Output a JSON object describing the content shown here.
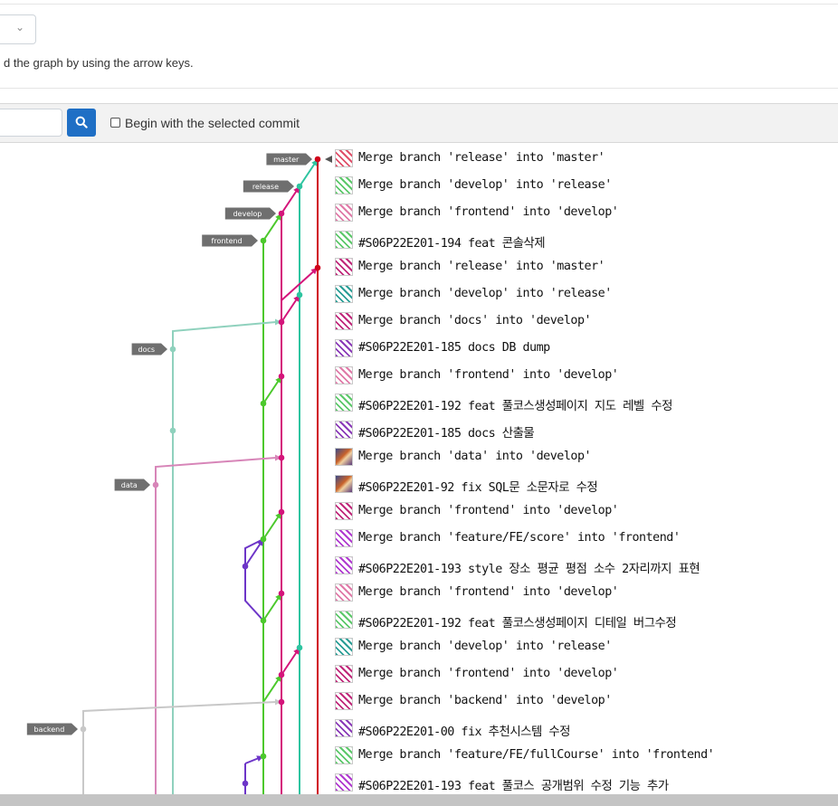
{
  "header": {
    "hint_text": "d the graph by using the arrow keys.",
    "dropdown_chevron": "⌄"
  },
  "toolbar": {
    "search_value": "",
    "search_icon": "search-icon",
    "begin_with_selected_label": "Begin with the selected commit",
    "begin_with_selected_checked": false
  },
  "branch_tags": [
    "master",
    "release",
    "develop",
    "frontend",
    "docs",
    "data",
    "backend"
  ],
  "colors": {
    "master": "#d0021b",
    "release": "#2ec4a0",
    "develop": "#d4147a",
    "frontend": "#4cc82c",
    "docs": "#8fd1bd",
    "data": "#d785b8",
    "backend": "#c8c8c8",
    "feature": "#6d35c8",
    "search_button": "#1f6fc5",
    "tag_bg": "#6f6f6f"
  },
  "commits": [
    {
      "message": "Merge branch 'release' into 'master'",
      "avatar": "identicon-red-pattern"
    },
    {
      "message": "Merge branch 'develop' into 'release'",
      "avatar": "identicon-green-pattern"
    },
    {
      "message": "Merge branch 'frontend' into 'develop'",
      "avatar": "identicon-pink-pattern"
    },
    {
      "message": "#S06P22E201-194 feat 콘솔삭제",
      "avatar": "identicon-green-pattern"
    },
    {
      "message": "Merge branch 'release' into 'master'",
      "avatar": "identicon-magenta-pattern"
    },
    {
      "message": "Merge branch 'develop' into 'release'",
      "avatar": "identicon-teal-pattern"
    },
    {
      "message": "Merge branch 'docs' into 'develop'",
      "avatar": "identicon-magenta-pattern"
    },
    {
      "message": "#S06P22E201-185 docs DB dump",
      "avatar": "identicon-purple-pattern"
    },
    {
      "message": "Merge branch 'frontend' into 'develop'",
      "avatar": "identicon-pink-pattern"
    },
    {
      "message": "#S06P22E201-192 feat 풀코스생성페이지 지도 레벨 수정",
      "avatar": "identicon-green-pattern"
    },
    {
      "message": "#S06P22E201-185 docs 산출물",
      "avatar": "identicon-purple-pattern"
    },
    {
      "message": "Merge branch 'data' into 'develop'",
      "avatar": "photo-avatar"
    },
    {
      "message": "#S06P22E201-92 fix SQL문 소문자로 수정",
      "avatar": "photo-avatar"
    },
    {
      "message": "Merge branch 'frontend' into 'develop'",
      "avatar": "identicon-magenta-pattern"
    },
    {
      "message": "Merge branch 'feature/FE/score' into 'frontend'",
      "avatar": "identicon-violet-pattern"
    },
    {
      "message": "#S06P22E201-193 style 장소 평균 평점 소수 2자리까지 표현",
      "avatar": "identicon-violet-pattern"
    },
    {
      "message": "Merge branch 'frontend' into 'develop'",
      "avatar": "identicon-pink-pattern"
    },
    {
      "message": "#S06P22E201-192 feat 풀코스생성페이지 디테일 버그수정",
      "avatar": "identicon-green-pattern"
    },
    {
      "message": "Merge branch 'develop' into 'release'",
      "avatar": "identicon-teal-pattern"
    },
    {
      "message": "Merge branch 'frontend' into 'develop'",
      "avatar": "identicon-magenta-pattern"
    },
    {
      "message": "Merge branch 'backend' into 'develop'",
      "avatar": "identicon-magenta-pattern"
    },
    {
      "message": "#S06P22E201-00 fix 추천시스템 수정",
      "avatar": "identicon-purple-pattern"
    },
    {
      "message": "Merge branch 'feature/FE/fullCourse' into 'frontend'",
      "avatar": "identicon-green-pattern"
    },
    {
      "message": "#S06P22E201-193 feat 풀코스 공개범위 수정 기능 추가",
      "avatar": "identicon-violet-pattern"
    }
  ]
}
